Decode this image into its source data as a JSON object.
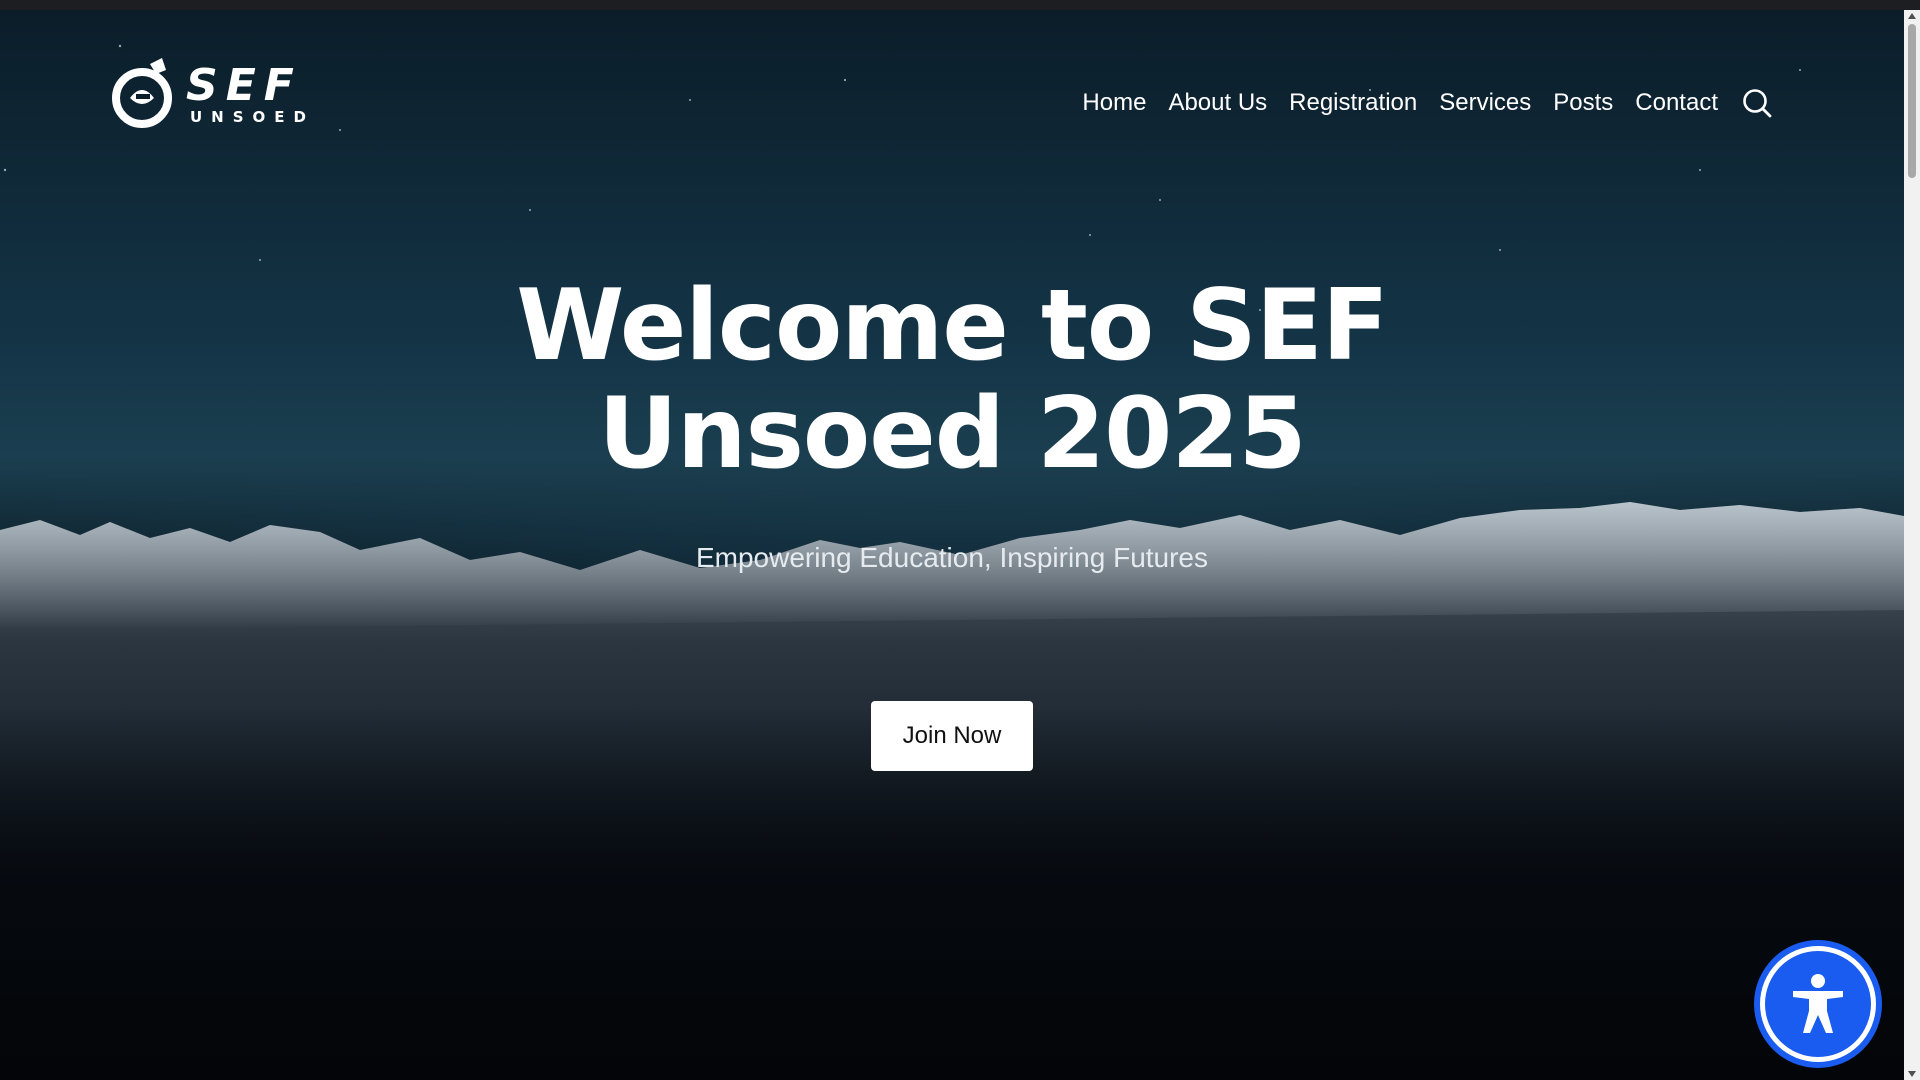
{
  "header": {
    "logo": {
      "main": "SEF",
      "sub": "UNSOED"
    },
    "nav": [
      {
        "label": "Home"
      },
      {
        "label": "About Us"
      },
      {
        "label": "Registration"
      },
      {
        "label": "Services"
      },
      {
        "label": "Posts"
      },
      {
        "label": "Contact"
      }
    ],
    "search_icon": "search-icon"
  },
  "hero": {
    "title_line1": "Welcome to SEF",
    "title_line2": "Unsoed 2025",
    "subtitle": "Empowering Education, Inspiring Futures",
    "cta_label": "Join Now"
  },
  "accessibility": {
    "icon": "accessibility-icon"
  },
  "colors": {
    "accent": "#1a5cf0",
    "text": "#ffffff",
    "background": "#060d14"
  }
}
